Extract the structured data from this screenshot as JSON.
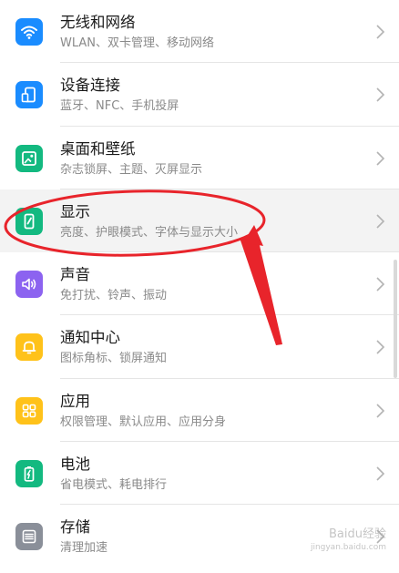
{
  "items": [
    {
      "title": "无线和网络",
      "subtitle": "WLAN、双卡管理、移动网络",
      "icon": "wifi-icon",
      "color": "#1a8cff"
    },
    {
      "title": "设备连接",
      "subtitle": "蓝牙、NFC、手机投屏",
      "icon": "device-connection-icon",
      "color": "#1a8cff"
    },
    {
      "title": "桌面和壁纸",
      "subtitle": "杂志锁屏、主题、灭屏显示",
      "icon": "wallpaper-icon",
      "color": "#13b980"
    },
    {
      "title": "显示",
      "subtitle": "亮度、护眼模式、字体与显示大小",
      "icon": "display-icon",
      "color": "#13b980"
    },
    {
      "title": "声音",
      "subtitle": "免打扰、铃声、振动",
      "icon": "sound-icon",
      "color": "#8c63f0"
    },
    {
      "title": "通知中心",
      "subtitle": "图标角标、锁屏通知",
      "icon": "bell-icon",
      "color": "#ffc21a"
    },
    {
      "title": "应用",
      "subtitle": "权限管理、默认应用、应用分身",
      "icon": "apps-grid-icon",
      "color": "#ffc21a"
    },
    {
      "title": "电池",
      "subtitle": "省电模式、耗电排行",
      "icon": "battery-icon",
      "color": "#13b980"
    },
    {
      "title": "存储",
      "subtitle": "清理加速",
      "icon": "storage-icon",
      "color": "#8a8f99"
    }
  ],
  "highlight_color": "#e8242b",
  "watermark": {
    "text": "Baidu经验",
    "sub": "jingyan.baidu.com"
  }
}
